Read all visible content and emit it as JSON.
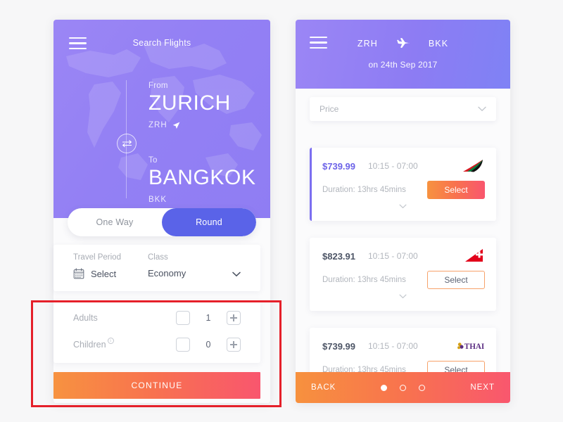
{
  "search_screen": {
    "header_title": "Search Flights",
    "menu_icon": "hamburger-menu-icon",
    "swap_icon": "swap-arrows-icon",
    "from": {
      "label": "From",
      "city": "ZURICH",
      "code": "ZRH",
      "locate_icon": "location-arrow-icon"
    },
    "to": {
      "label": "To",
      "city": "BANGKOK",
      "code": "BKK"
    },
    "trip_toggle": {
      "options": [
        "One Way",
        "Round"
      ],
      "selected": "Round"
    },
    "travel_period": {
      "label": "Travel Period",
      "value": "Select",
      "icon": "calendar-icon"
    },
    "travel_class": {
      "label": "Class",
      "value": "Economy",
      "icon": "chevron-down-icon"
    },
    "passengers": [
      {
        "label": "Adults",
        "count": "1",
        "minus_icon": "minus-box-icon",
        "plus_icon": "plus-box-icon",
        "has_info": false
      },
      {
        "label": "Children",
        "count": "0",
        "minus_icon": "minus-box-icon",
        "plus_icon": "plus-box-icon",
        "has_info": true,
        "info_icon": "info-circle-icon"
      }
    ],
    "continue_label": "CONTINUE",
    "colors": {
      "hero_purple": "#9380f4",
      "toggle_active": "#5a63e8",
      "cta_start": "#f79240",
      "cta_end": "#f9566e"
    }
  },
  "results_screen": {
    "menu_icon": "hamburger-menu-icon",
    "origin": "ZRH",
    "plane_icon": "airplane-icon",
    "destination": "BKK",
    "date_text": "on 24th Sep 2017",
    "sort": {
      "value": "Price",
      "icon": "chevron-down-icon"
    },
    "flights": [
      {
        "price": "$739.99",
        "times": "10:15 - 07:00",
        "duration": "Duration: 13hrs 45mins",
        "airline_logo": "emirates-logo",
        "select_label": "Select",
        "select_style": "filled",
        "highlighted": true,
        "expand_icon": "chevron-down-icon"
      },
      {
        "price": "$823.91",
        "times": "10:15 - 07:00",
        "duration": "Duration: 13hrs 45mins",
        "airline_logo": "swiss-air-logo",
        "select_label": "Select",
        "select_style": "outline",
        "highlighted": false,
        "expand_icon": "chevron-down-icon"
      },
      {
        "price": "$739.99",
        "times": "10:15 - 07:00",
        "duration": "Duration: 13hrs 45mins",
        "airline_logo": "thai-airways-logo",
        "select_label": "Select",
        "select_style": "outline",
        "highlighted": false,
        "expand_icon": "chevron-down-icon"
      }
    ],
    "bottom_nav": {
      "back_label": "BACK",
      "next_label": "NEXT",
      "pages": 3,
      "active_page": 1
    }
  }
}
